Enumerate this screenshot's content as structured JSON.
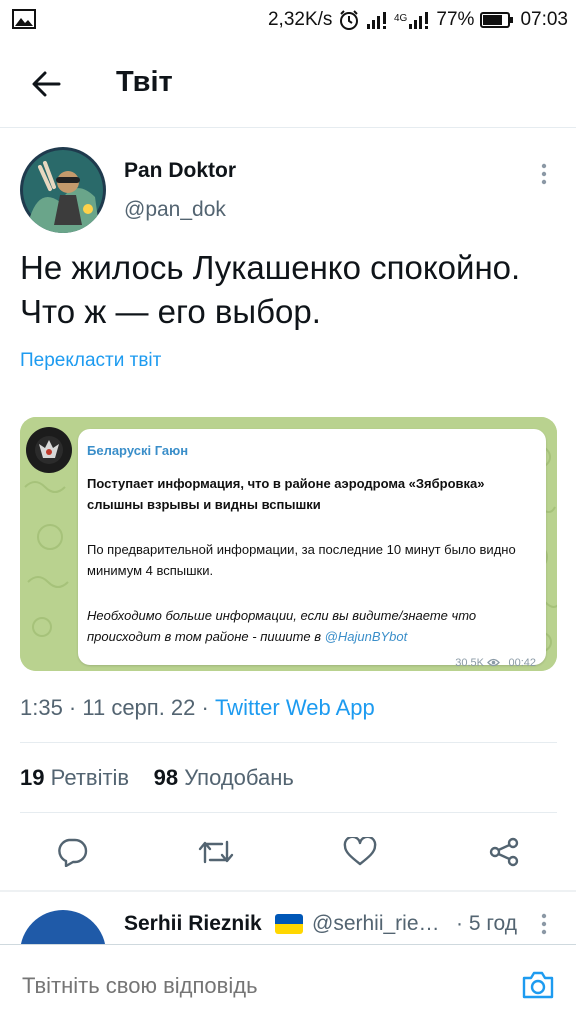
{
  "status_bar": {
    "network_speed": "2,32K/s",
    "network_type": "4G",
    "battery": "77%",
    "time": "07:03",
    "icons": [
      "image-icon",
      "alarm-icon",
      "signal-icon",
      "signal-4g-icon",
      "battery-icon"
    ]
  },
  "header": {
    "title": "Твіт",
    "back_icon": "arrow-left-icon"
  },
  "tweet": {
    "author_name": "Pan Doktor",
    "author_handle": "@pan_dok",
    "text": "Не жилось Лукашенко спокойно. Что ж — его выбор.",
    "translate_label": "Перекласти твіт",
    "timestamp": "1:35 · 11 серп. 22 · ",
    "source_app": "Twitter Web App",
    "retweets_count": "19",
    "retweets_label": "Ретвітів",
    "likes_count": "98",
    "likes_label": "Уподобань",
    "action_icons": [
      "reply-icon",
      "retweet-icon",
      "like-icon",
      "share-icon"
    ]
  },
  "embedded_message": {
    "channel": "Беларускі Гаюн",
    "paragraph1": "Поступает информация, что в районе аэродрома «Зябровка» слышны взрывы и видны вспышки",
    "paragraph2": "По предварительной информации, за последние 10 минут было видно минимум 4 вспышки.",
    "paragraph3": "Необходимо больше информации, если вы видите/знаете что происходит в том районе - пишите в ",
    "mention": "@HajunBYbot",
    "views": "30.5K",
    "time": "00:42",
    "colors": {
      "background": "#b9d28f",
      "link": "#3a8ec9"
    }
  },
  "reply": {
    "author_name": "Serhii Rieznik",
    "author_handle": "@serhii_rie…",
    "time": "· 5 год"
  },
  "composer": {
    "placeholder": "Твітніть свою відповідь",
    "camera_icon": "camera-icon"
  },
  "colors": {
    "accent": "#1d9bf0",
    "secondary_text": "#536471",
    "primary_text": "#0f1419"
  }
}
